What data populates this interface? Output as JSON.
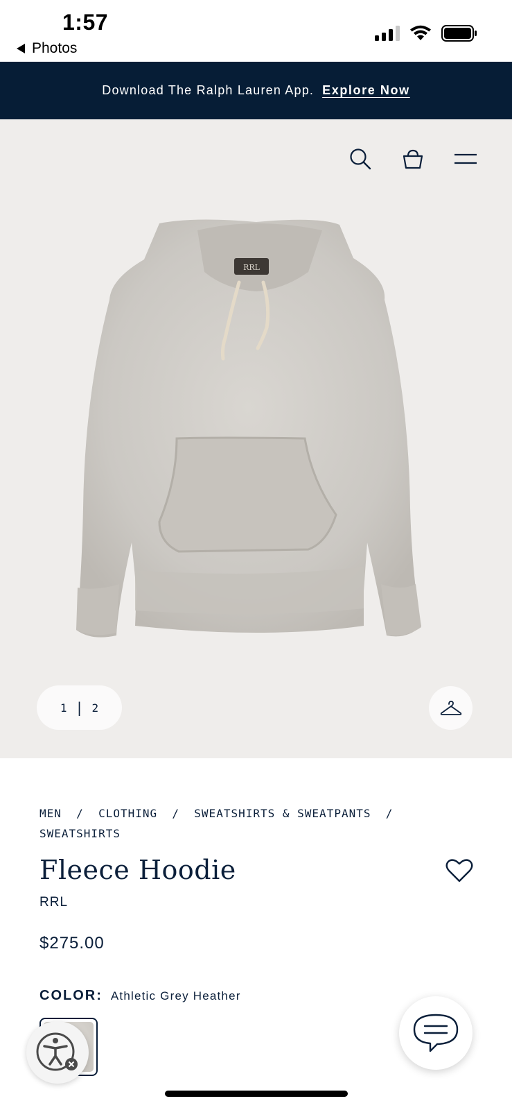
{
  "status_bar": {
    "time": "1:57",
    "back_label": "Photos"
  },
  "banner": {
    "text": "Download The Ralph Lauren App.",
    "link": "Explore Now"
  },
  "hero": {
    "pager": {
      "current": "1",
      "separator": "|",
      "total": "2"
    },
    "icons": [
      "search-icon",
      "shopping-bag-icon",
      "menu-icon",
      "hanger-icon"
    ]
  },
  "product": {
    "breadcrumb_line1": "MEN  /  CLOTHING  /  SWEATSHIRTS & SWEATPANTS  /",
    "breadcrumb_line2": "SWEATSHIRTS",
    "title": "Fleece Hoodie",
    "brand": "RRL",
    "price": "$275.00",
    "color_label": "COLOR:",
    "color_value": "Athletic Grey Heather"
  },
  "colors": {
    "navy": "#061d36",
    "text": "#0b1f3a",
    "hero_bg": "#efedeb"
  }
}
